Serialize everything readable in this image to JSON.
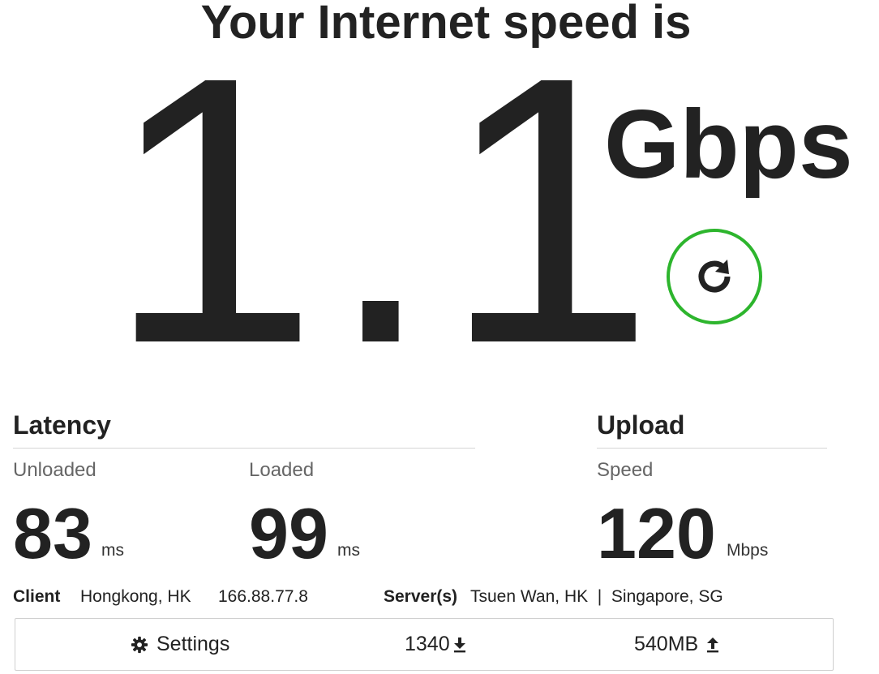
{
  "header": {
    "title": "Your Internet speed is"
  },
  "speed": {
    "value": "1.1",
    "unit": "Gbps"
  },
  "reload": {
    "icon": "reload-icon",
    "accent": "#2db52d"
  },
  "latency": {
    "title": "Latency",
    "unloaded": {
      "label": "Unloaded",
      "value": "83",
      "unit": "ms"
    },
    "loaded": {
      "label": "Loaded",
      "value": "99",
      "unit": "ms"
    }
  },
  "upload": {
    "title": "Upload",
    "speed": {
      "label": "Speed",
      "value": "120",
      "unit": "Mbps"
    }
  },
  "client": {
    "label": "Client",
    "location": "Hongkong, HK",
    "ip": "166.88.77.8"
  },
  "servers": {
    "label": "Server(s)",
    "list": "Tsuen Wan, HK  |  Singapore, SG"
  },
  "toolbar": {
    "settings_label": "Settings",
    "settings_icon": "gear-icon",
    "download_value": "1340",
    "download_icon": "download-icon",
    "upload_value": "540MB",
    "upload_icon": "upload-icon"
  }
}
